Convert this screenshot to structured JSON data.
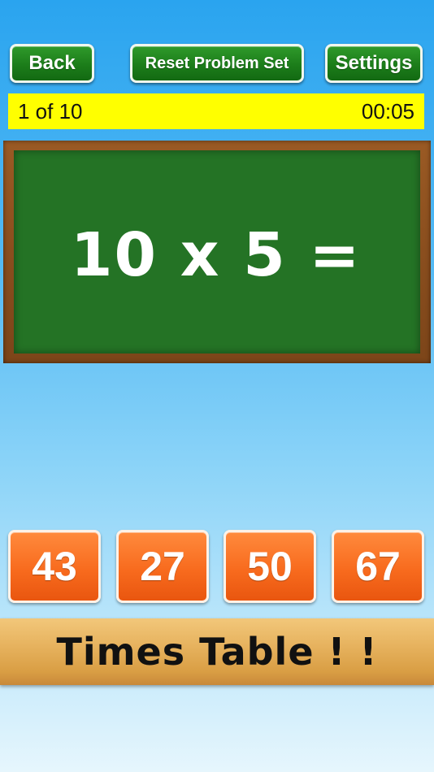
{
  "toolbar": {
    "back_label": "Back",
    "reset_label": "Reset Problem Set",
    "settings_label": "Settings"
  },
  "status": {
    "progress": "1 of 10",
    "timer": "00:05"
  },
  "board": {
    "equation": "10 x 5 ="
  },
  "answers": [
    "43",
    "27",
    "50",
    "67"
  ],
  "footer": {
    "title": "Times Table ! !"
  },
  "colors": {
    "button_green": "#1c7d1a",
    "status_yellow": "#ffff00",
    "chalkboard": "#247325",
    "answer_orange": "#f86b1e",
    "wood": "#e7b35f"
  }
}
